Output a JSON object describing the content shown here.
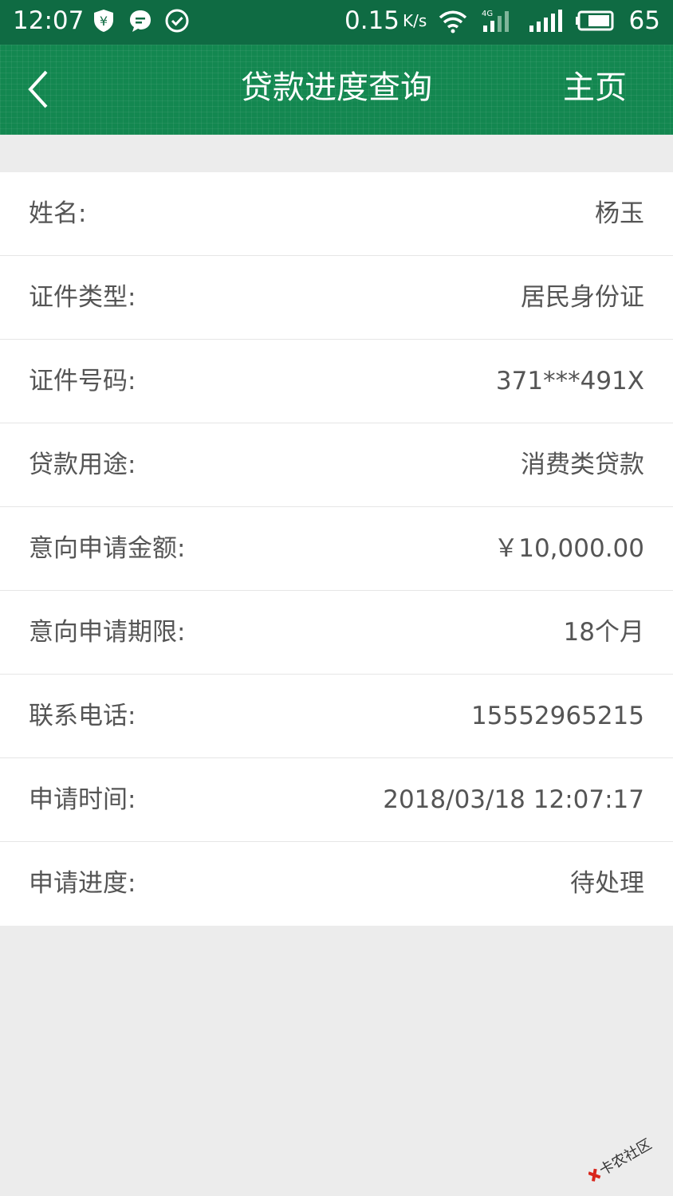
{
  "status_bar": {
    "time": "12:07",
    "net_speed": "0.15",
    "net_unit": "K/s",
    "network_type": "4G",
    "battery": "65"
  },
  "header": {
    "title": "贷款进度查询",
    "home_label": "主页"
  },
  "details": [
    {
      "label": "姓名:",
      "value": "杨玉"
    },
    {
      "label": "证件类型:",
      "value": "居民身份证"
    },
    {
      "label": "证件号码:",
      "value": "371***491X"
    },
    {
      "label": "贷款用途:",
      "value": "消费类贷款"
    },
    {
      "label": "意向申请金额:",
      "value": "￥10,000.00"
    },
    {
      "label": "意向申请期限:",
      "value": "18个月"
    },
    {
      "label": "联系电话:",
      "value": "15552965215"
    },
    {
      "label": "申请时间:",
      "value": "2018/03/18 12:07:17"
    },
    {
      "label": "申请进度:",
      "value": "待处理"
    }
  ],
  "watermark": {
    "text": "卡农社区"
  },
  "colors": {
    "status_bar": "#0f6b43",
    "nav_bar": "#138750",
    "page_background": "#ececec",
    "text": "#555555"
  }
}
